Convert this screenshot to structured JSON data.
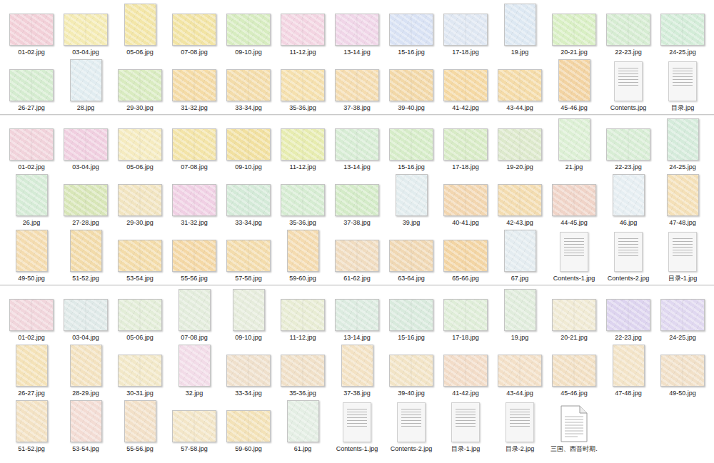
{
  "sections": [
    {
      "items": [
        {
          "name": "01-02.jpg",
          "kind": "landscape",
          "color": "#f2d0d8"
        },
        {
          "name": "03-04.jpg",
          "kind": "landscape",
          "color": "#f4ebb4"
        },
        {
          "name": "05-06.jpg",
          "kind": "portrait",
          "color": "#f3e6a8"
        },
        {
          "name": "07-08.jpg",
          "kind": "landscape",
          "color": "#f2e4a4"
        },
        {
          "name": "09-10.jpg",
          "kind": "landscape",
          "color": "#d7ecc0"
        },
        {
          "name": "11-12.jpg",
          "kind": "landscape",
          "color": "#f3d5e2"
        },
        {
          "name": "13-14.jpg",
          "kind": "landscape",
          "color": "#f0d6e8"
        },
        {
          "name": "15-16.jpg",
          "kind": "landscape",
          "color": "#d9e2f4"
        },
        {
          "name": "17-18.jpg",
          "kind": "landscape",
          "color": "#dfe7f2"
        },
        {
          "name": "19.jpg",
          "kind": "portrait",
          "color": "#dde8f2"
        },
        {
          "name": "20-21.jpg",
          "kind": "landscape",
          "color": "#d9efc4"
        },
        {
          "name": "22-23.jpg",
          "kind": "landscape",
          "color": "#d6ecd2"
        },
        {
          "name": "24-25.jpg",
          "kind": "landscape",
          "color": "#d3ecd8"
        },
        {
          "name": "26-27.jpg",
          "kind": "landscape",
          "color": "#d5ecd0"
        },
        {
          "name": "28.jpg",
          "kind": "portrait",
          "color": "#e1ecf0"
        },
        {
          "name": "29-30.jpg",
          "kind": "landscape",
          "color": "#d9ebc0"
        },
        {
          "name": "31-32.jpg",
          "kind": "landscape",
          "color": "#f4dba6"
        },
        {
          "name": "33-34.jpg",
          "kind": "landscape",
          "color": "#f3dcaa"
        },
        {
          "name": "35-36.jpg",
          "kind": "landscape",
          "color": "#f5e0ae"
        },
        {
          "name": "37-38.jpg",
          "kind": "landscape",
          "color": "#f4dcb0"
        },
        {
          "name": "39-40.jpg",
          "kind": "landscape",
          "color": "#f2d8a8"
        },
        {
          "name": "41-42.jpg",
          "kind": "landscape",
          "color": "#f5d9a4"
        },
        {
          "name": "43-44.jpg",
          "kind": "landscape",
          "color": "#f4dba8"
        },
        {
          "name": "45-46.jpg",
          "kind": "portrait",
          "color": "#f2d3a2"
        },
        {
          "name": "Contents.jpg",
          "kind": "document"
        },
        {
          "name": "目录.jpg",
          "kind": "document"
        }
      ]
    },
    {
      "items": [
        {
          "name": "01-02.jpg",
          "kind": "landscape",
          "color": "#f1d3db"
        },
        {
          "name": "03-04.jpg",
          "kind": "landscape",
          "color": "#f0cfe0"
        },
        {
          "name": "05-06.jpg",
          "kind": "landscape",
          "color": "#f5ebc0"
        },
        {
          "name": "07-08.jpg",
          "kind": "landscape",
          "color": "#f3e4a8"
        },
        {
          "name": "09-10.jpg",
          "kind": "landscape",
          "color": "#f1e0a0"
        },
        {
          "name": "11-12.jpg",
          "kind": "landscape",
          "color": "#e7ecb0"
        },
        {
          "name": "13-14.jpg",
          "kind": "landscape",
          "color": "#d7ecd4"
        },
        {
          "name": "15-16.jpg",
          "kind": "landscape",
          "color": "#d6ecc8"
        },
        {
          "name": "17-18.jpg",
          "kind": "landscape",
          "color": "#d8ebc6"
        },
        {
          "name": "19-20.jpg",
          "kind": "landscape",
          "color": "#dde9cc"
        },
        {
          "name": "21.jpg",
          "kind": "portrait",
          "color": "#dcefd4"
        },
        {
          "name": "22-23.jpg",
          "kind": "landscape",
          "color": "#d8edd5"
        },
        {
          "name": "24-25.jpg",
          "kind": "portrait",
          "color": "#d5ebdb"
        },
        {
          "name": "26.jpg",
          "kind": "portrait",
          "color": "#d5ebd6"
        },
        {
          "name": "27-28.jpg",
          "kind": "landscape",
          "color": "#d8e6b8"
        },
        {
          "name": "29-30.jpg",
          "kind": "landscape",
          "color": "#f1e4c0"
        },
        {
          "name": "31-32.jpg",
          "kind": "landscape",
          "color": "#f0d0e4"
        },
        {
          "name": "33-34.jpg",
          "kind": "landscape",
          "color": "#d4ead8"
        },
        {
          "name": "35-36.jpg",
          "kind": "landscape",
          "color": "#d6ecd2"
        },
        {
          "name": "37-38.jpg",
          "kind": "landscape",
          "color": "#d4ebc8"
        },
        {
          "name": "39.jpg",
          "kind": "portrait",
          "color": "#e2ecee"
        },
        {
          "name": "40-41.jpg",
          "kind": "landscape",
          "color": "#f2d6b0"
        },
        {
          "name": "42-43.jpg",
          "kind": "landscape",
          "color": "#f3dcb0"
        },
        {
          "name": "44-45.jpg",
          "kind": "landscape",
          "color": "#f0d4c8"
        },
        {
          "name": "46.jpg",
          "kind": "portrait",
          "color": "#e6eef2"
        },
        {
          "name": "47-48.jpg",
          "kind": "portrait",
          "color": "#f4e0b8"
        },
        {
          "name": "49-50.jpg",
          "kind": "portrait",
          "color": "#f4dcb0"
        },
        {
          "name": "51-52.jpg",
          "kind": "portrait",
          "color": "#f2dbaa"
        },
        {
          "name": "53-54.jpg",
          "kind": "landscape",
          "color": "#f3dcaa"
        },
        {
          "name": "55-56.jpg",
          "kind": "landscape",
          "color": "#f4d8a6"
        },
        {
          "name": "57-58.jpg",
          "kind": "landscape",
          "color": "#f3dcac"
        },
        {
          "name": "59-60.jpg",
          "kind": "portrait",
          "color": "#f4dbb0"
        },
        {
          "name": "61-62.jpg",
          "kind": "landscape",
          "color": "#f0dcc0"
        },
        {
          "name": "63-64.jpg",
          "kind": "landscape",
          "color": "#f0d8b4"
        },
        {
          "name": "65-66.jpg",
          "kind": "landscape",
          "color": "#f3d5a4"
        },
        {
          "name": "67.jpg",
          "kind": "portrait",
          "color": "#e4ecf0"
        },
        {
          "name": "Contents-1.jpg",
          "kind": "document"
        },
        {
          "name": "Contents-2.jpg",
          "kind": "document"
        },
        {
          "name": "目录-1.jpg",
          "kind": "document"
        }
      ]
    },
    {
      "items": [
        {
          "name": "01-02.jpg",
          "kind": "landscape",
          "color": "#f1d6dc"
        },
        {
          "name": "03-04.jpg",
          "kind": "landscape",
          "color": "#dfe9e8"
        },
        {
          "name": "05-06.jpg",
          "kind": "landscape",
          "color": "#e3edd8"
        },
        {
          "name": "07-08.jpg",
          "kind": "portrait",
          "color": "#e3ecdc"
        },
        {
          "name": "09-10.jpg",
          "kind": "portrait",
          "color": "#e6ecdc"
        },
        {
          "name": "11-12.jpg",
          "kind": "landscape",
          "color": "#e8ecd4"
        },
        {
          "name": "13-14.jpg",
          "kind": "landscape",
          "color": "#dcebe0"
        },
        {
          "name": "15-16.jpg",
          "kind": "landscape",
          "color": "#d9eadd"
        },
        {
          "name": "17-18.jpg",
          "kind": "landscape",
          "color": "#dfedd8"
        },
        {
          "name": "19.jpg",
          "kind": "portrait",
          "color": "#e0ecdc"
        },
        {
          "name": "20-21.jpg",
          "kind": "landscape",
          "color": "#f0ead4"
        },
        {
          "name": "22-23.jpg",
          "kind": "landscape",
          "color": "#ddd4ef"
        },
        {
          "name": "24-25.jpg",
          "kind": "landscape",
          "color": "#e0d8f0"
        },
        {
          "name": "26-27.jpg",
          "kind": "portrait",
          "color": "#f4e2b8"
        },
        {
          "name": "28-29.jpg",
          "kind": "portrait",
          "color": "#f3e2c0"
        },
        {
          "name": "30-31.jpg",
          "kind": "landscape",
          "color": "#f2e8c8"
        },
        {
          "name": "32.jpg",
          "kind": "portrait",
          "color": "#f2dce8"
        },
        {
          "name": "33-34.jpg",
          "kind": "landscape",
          "color": "#efe0cc"
        },
        {
          "name": "35-36.jpg",
          "kind": "landscape",
          "color": "#f0e0c8"
        },
        {
          "name": "37-38.jpg",
          "kind": "portrait",
          "color": "#f3e2c4"
        },
        {
          "name": "39-40.jpg",
          "kind": "landscape",
          "color": "#f2e4c6"
        },
        {
          "name": "41-42.jpg",
          "kind": "landscape",
          "color": "#f2dcc8"
        },
        {
          "name": "43-44.jpg",
          "kind": "landscape",
          "color": "#f3e0c8"
        },
        {
          "name": "45-46.jpg",
          "kind": "landscape",
          "color": "#f2e0c4"
        },
        {
          "name": "47-48.jpg",
          "kind": "portrait",
          "color": "#f3e4c8"
        },
        {
          "name": "49-50.jpg",
          "kind": "landscape",
          "color": "#f1e0c8"
        },
        {
          "name": "51-52.jpg",
          "kind": "portrait",
          "color": "#f3e2c4"
        },
        {
          "name": "53-54.jpg",
          "kind": "portrait",
          "color": "#f3dcd4"
        },
        {
          "name": "55-56.jpg",
          "kind": "portrait",
          "color": "#f2e0c8"
        },
        {
          "name": "57-58.jpg",
          "kind": "landscape",
          "color": "#f3e6c8"
        },
        {
          "name": "59-60.jpg",
          "kind": "landscape",
          "color": "#f3e2b8"
        },
        {
          "name": "61.jpg",
          "kind": "portrait",
          "color": "#e4eee4"
        },
        {
          "name": "Contents-1.jpg",
          "kind": "document"
        },
        {
          "name": "Contents-2.jpg",
          "kind": "document"
        },
        {
          "name": "目录-1.jpg",
          "kind": "document"
        },
        {
          "name": "目录-2.jpg",
          "kind": "document"
        },
        {
          "name": "三国、西晋时期.",
          "kind": "blank"
        }
      ]
    }
  ]
}
